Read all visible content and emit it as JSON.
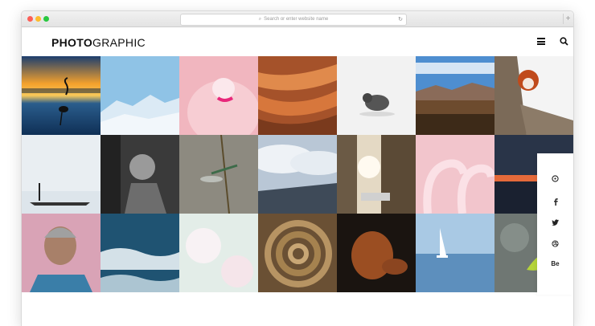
{
  "browser": {
    "url_placeholder": "Search or enter website name",
    "newtab_label": "+"
  },
  "header": {
    "logo_bold": "PHOTO",
    "logo_light": "GRAPHIC",
    "icons": [
      "menu-icon",
      "search-icon"
    ]
  },
  "gallery": {
    "tiles": [
      "sunset-flamingo-silhouette",
      "snowy-mountains",
      "pink-flamingo-closeup",
      "sandstone-canyon",
      "small-bird-on-snow",
      "desert-mountains",
      "red-panda-in-tree",
      "fisherman-in-mist",
      "child-black-white",
      "dragonfly-on-stem",
      "clouds-road",
      "city-street-sunlight",
      "flamingos-necks",
      "sunset-horizon",
      "elderly-woman-portrait",
      "ocean-waves",
      "dandelion-seeds",
      "coiled-rope",
      "brown-dog",
      "sailboat-on-lake",
      "green-leaf-bokeh"
    ]
  },
  "social": {
    "icons": [
      "pinterest-icon",
      "facebook-icon",
      "twitter-icon",
      "dribbble-icon",
      "behance-icon"
    ],
    "behance_label": "Be"
  }
}
